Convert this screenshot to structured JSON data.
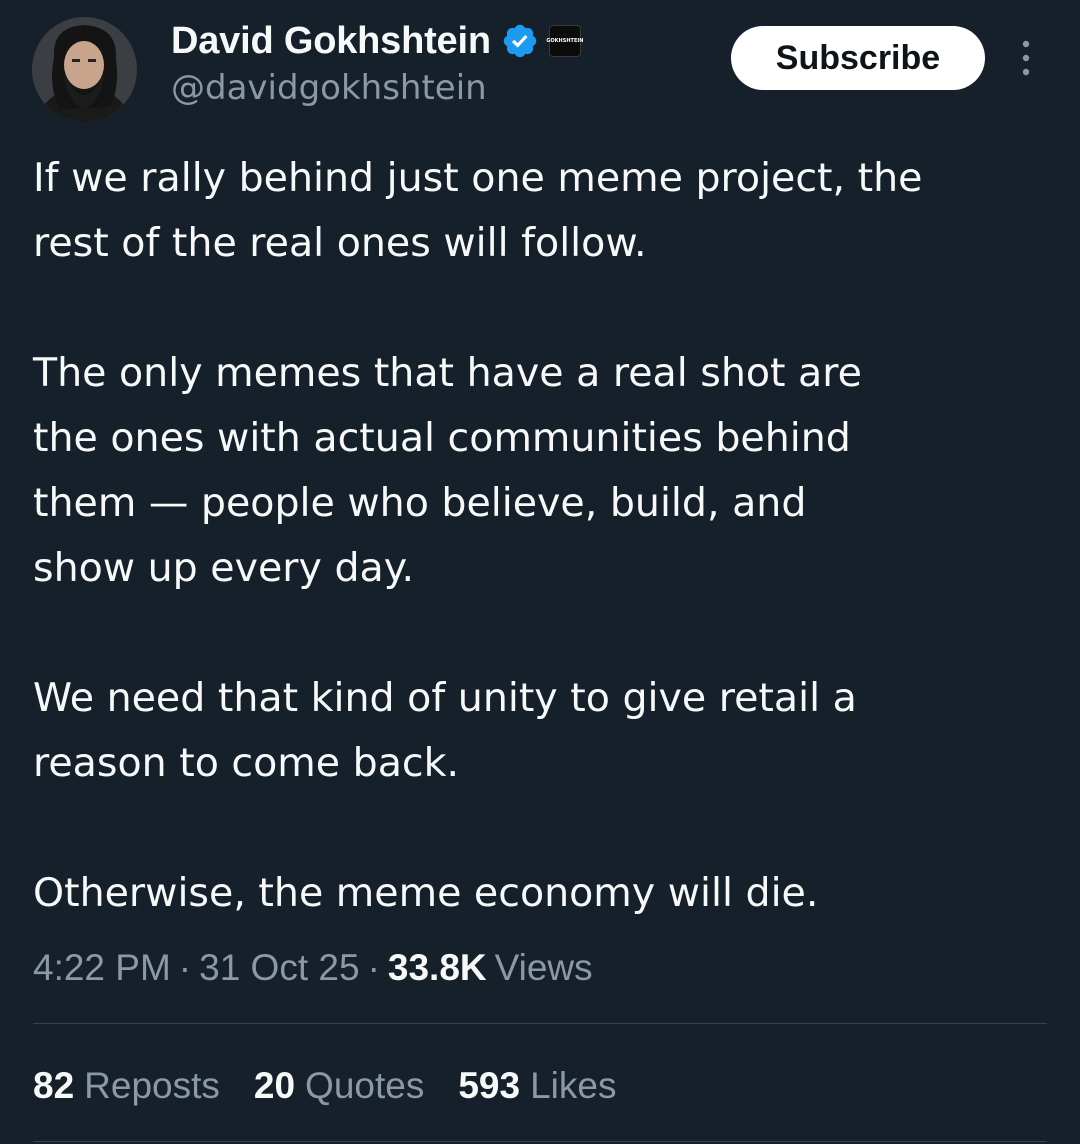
{
  "author": {
    "display_name": "David Gokhshtein",
    "handle": "@davidgokhshtein",
    "verified_icon": "verified-badge-icon",
    "verified_color": "#1d9bf0",
    "org_badge_text": "GOKHSHTEIN"
  },
  "header": {
    "subscribe_label": "Subscribe",
    "more_icon": "more-vertical-icon"
  },
  "tweet": {
    "paragraphs": [
      "If we rally behind just one meme project, the\nrest of the real ones will follow.",
      "The only memes that have a real shot are\nthe ones with actual communities behind\nthem — people who believe, build, and\nshow up every day.",
      "We need that kind of unity to give retail a\nreason to come back.",
      "Otherwise, the meme economy will die."
    ]
  },
  "meta": {
    "time": "4:22 PM",
    "date": "31 Oct 25",
    "views_count": "33.8K",
    "views_label": "Views",
    "separator": "·"
  },
  "stats": {
    "reposts_count": "82",
    "reposts_label": "Reposts",
    "quotes_count": "20",
    "quotes_label": "Quotes",
    "likes_count": "593",
    "likes_label": "Likes"
  },
  "colors": {
    "background": "#15202b",
    "primary_text": "#f7f9f9",
    "secondary_text": "#8b98a5",
    "divider": "#38444d"
  }
}
